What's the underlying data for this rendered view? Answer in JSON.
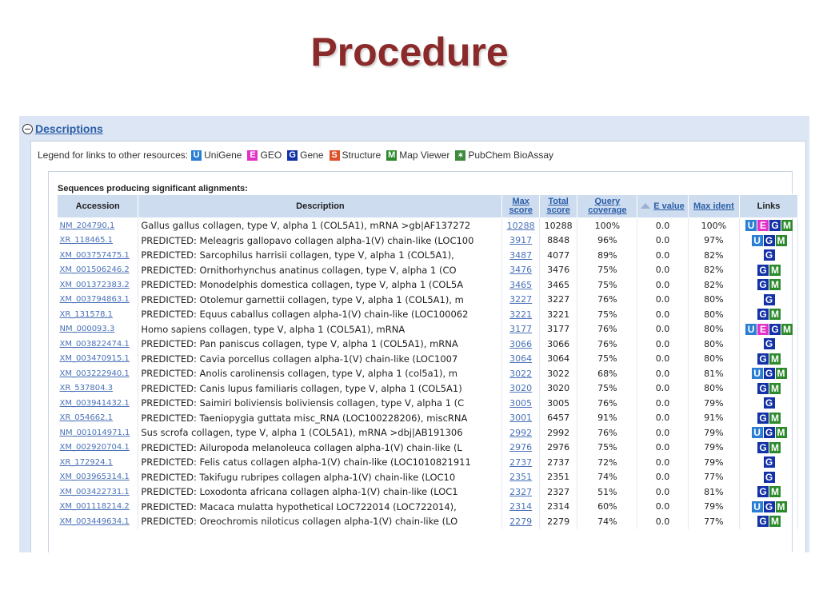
{
  "slide": {
    "title": "Procedure"
  },
  "descriptions": {
    "title": "Descriptions",
    "legend_prefix": "Legend for links to other resources:",
    "legend": [
      {
        "icon": "U",
        "label": "UniGene",
        "color": "#2a7fd4"
      },
      {
        "icon": "E",
        "label": "GEO",
        "color": "#e033c6"
      },
      {
        "icon": "G",
        "label": "Gene",
        "color": "#1432a8"
      },
      {
        "icon": "S",
        "label": "Structure",
        "color": "#e0502a"
      },
      {
        "icon": "M",
        "label": "Map Viewer",
        "color": "#2c8a2c"
      },
      {
        "icon": "pubchem-icon",
        "label": "PubChem BioAssay",
        "color": "#3c8a3c"
      }
    ],
    "section_title": "Sequences producing significant alignments:",
    "columns": [
      "Accession",
      "Description",
      "Max score",
      "Total score",
      "Query coverage",
      "E value",
      "Max ident",
      "Links"
    ],
    "rows": [
      {
        "accession": "NM_204790.1",
        "description": "Gallus gallus collagen, type V, alpha 1 (COL5A1), mRNA >gb|AF137272",
        "max_score": "10288",
        "total_score": "10288",
        "coverage": "100%",
        "evalue": "0.0",
        "ident": "100%",
        "links": [
          "U",
          "E",
          "G",
          "M"
        ]
      },
      {
        "accession": "XR_118465.1",
        "description": "PREDICTED: Meleagris gallopavo collagen alpha-1(V) chain-like (LOC100",
        "max_score": "3917",
        "total_score": "8848",
        "coverage": "96%",
        "evalue": "0.0",
        "ident": "97%",
        "links": [
          "U",
          "G",
          "M"
        ]
      },
      {
        "accession": "XM_003757475.1",
        "description": "PREDICTED: Sarcophilus harrisii collagen, type V, alpha 1 (COL5A1),",
        "max_score": "3487",
        "total_score": "4077",
        "coverage": "89%",
        "evalue": "0.0",
        "ident": "82%",
        "links": [
          "G"
        ]
      },
      {
        "accession": "XM_001506246.2",
        "description": "PREDICTED: Ornithorhynchus anatinus collagen, type V, alpha 1 (CO",
        "max_score": "3476",
        "total_score": "3476",
        "coverage": "75%",
        "evalue": "0.0",
        "ident": "82%",
        "links": [
          "G",
          "M"
        ]
      },
      {
        "accession": "XM_001372383.2",
        "description": "PREDICTED: Monodelphis domestica collagen, type V, alpha 1 (COL5A",
        "max_score": "3465",
        "total_score": "3465",
        "coverage": "75%",
        "evalue": "0.0",
        "ident": "82%",
        "links": [
          "G",
          "M"
        ]
      },
      {
        "accession": "XM_003794863.1",
        "description": "PREDICTED: Otolemur garnettii collagen, type V, alpha 1 (COL5A1), m",
        "max_score": "3227",
        "total_score": "3227",
        "coverage": "76%",
        "evalue": "0.0",
        "ident": "80%",
        "links": [
          "G"
        ]
      },
      {
        "accession": "XR_131578.1",
        "description": "PREDICTED: Equus caballus collagen alpha-1(V) chain-like (LOC100062",
        "max_score": "3221",
        "total_score": "3221",
        "coverage": "75%",
        "evalue": "0.0",
        "ident": "80%",
        "links": [
          "G",
          "M"
        ]
      },
      {
        "accession": "NM_000093.3",
        "description": "Homo sapiens collagen, type V, alpha 1 (COL5A1), mRNA",
        "max_score": "3177",
        "total_score": "3177",
        "coverage": "76%",
        "evalue": "0.0",
        "ident": "80%",
        "links": [
          "U",
          "E",
          "G",
          "M"
        ]
      },
      {
        "accession": "XM_003822474.1",
        "description": "PREDICTED: Pan paniscus collagen, type V, alpha 1 (COL5A1), mRNA",
        "max_score": "3066",
        "total_score": "3066",
        "coverage": "76%",
        "evalue": "0.0",
        "ident": "80%",
        "links": [
          "G"
        ]
      },
      {
        "accession": "XM_003470915.1",
        "description": "PREDICTED: Cavia porcellus collagen alpha-1(V) chain-like (LOC1007",
        "max_score": "3064",
        "total_score": "3064",
        "coverage": "75%",
        "evalue": "0.0",
        "ident": "80%",
        "links": [
          "G",
          "M"
        ]
      },
      {
        "accession": "XM_003222940.1",
        "description": "PREDICTED: Anolis carolinensis collagen, type V, alpha 1 (col5a1), m",
        "max_score": "3022",
        "total_score": "3022",
        "coverage": "68%",
        "evalue": "0.0",
        "ident": "81%",
        "links": [
          "U",
          "G",
          "M"
        ]
      },
      {
        "accession": "XR_537804.3",
        "description": "PREDICTED: Canis lupus familiaris collagen, type V, alpha 1 (COL5A1)",
        "max_score": "3020",
        "total_score": "3020",
        "coverage": "75%",
        "evalue": "0.0",
        "ident": "80%",
        "links": [
          "G",
          "M"
        ]
      },
      {
        "accession": "XM_003941432.1",
        "description": "PREDICTED: Saimiri boliviensis boliviensis collagen, type V, alpha 1 (C",
        "max_score": "3005",
        "total_score": "3005",
        "coverage": "76%",
        "evalue": "0.0",
        "ident": "79%",
        "links": [
          "G"
        ]
      },
      {
        "accession": "XR_054662.1",
        "description": "PREDICTED: Taeniopygia guttata misc_RNA (LOC100228206), miscRNA",
        "max_score": "3001",
        "total_score": "6457",
        "coverage": "91%",
        "evalue": "0.0",
        "ident": "91%",
        "links": [
          "G",
          "M"
        ]
      },
      {
        "accession": "NM_001014971.1",
        "description": "Sus scrofa collagen, type V, alpha 1 (COL5A1), mRNA >dbj|AB191306",
        "max_score": "2992",
        "total_score": "2992",
        "coverage": "76%",
        "evalue": "0.0",
        "ident": "79%",
        "links": [
          "U",
          "G",
          "M"
        ]
      },
      {
        "accession": "XM_002920704.1",
        "description": "PREDICTED: Ailuropoda melanoleuca collagen alpha-1(V) chain-like (L",
        "max_score": "2976",
        "total_score": "2976",
        "coverage": "75%",
        "evalue": "0.0",
        "ident": "79%",
        "links": [
          "G",
          "M"
        ]
      },
      {
        "accession": "XR_172924.1",
        "description": "PREDICTED: Felis catus collagen alpha-1(V) chain-like (LOC1010821911",
        "max_score": "2737",
        "total_score": "2737",
        "coverage": "72%",
        "evalue": "0.0",
        "ident": "79%",
        "links": [
          "G"
        ]
      },
      {
        "accession": "XM_003965314.1",
        "description": "PREDICTED: Takifugu rubripes collagen alpha-1(V) chain-like (LOC10",
        "max_score": "2351",
        "total_score": "2351",
        "coverage": "74%",
        "evalue": "0.0",
        "ident": "77%",
        "links": [
          "G"
        ]
      },
      {
        "accession": "XM_003422731.1",
        "description": "PREDICTED: Loxodonta africana collagen alpha-1(V) chain-like (LOC1",
        "max_score": "2327",
        "total_score": "2327",
        "coverage": "51%",
        "evalue": "0.0",
        "ident": "81%",
        "links": [
          "G",
          "M"
        ]
      },
      {
        "accession": "XM_001118214.2",
        "description": "PREDICTED: Macaca mulatta hypothetical LOC722014 (LOC722014),",
        "max_score": "2314",
        "total_score": "2314",
        "coverage": "60%",
        "evalue": "0.0",
        "ident": "79%",
        "links": [
          "U",
          "G",
          "M"
        ]
      },
      {
        "accession": "XM_003449634.1",
        "description": "PREDICTED: Oreochromis niloticus collagen alpha-1(V) chain-like (LO",
        "max_score": "2279",
        "total_score": "2279",
        "coverage": "74%",
        "evalue": "0.0",
        "ident": "77%",
        "links": [
          "G",
          "M"
        ]
      }
    ]
  }
}
